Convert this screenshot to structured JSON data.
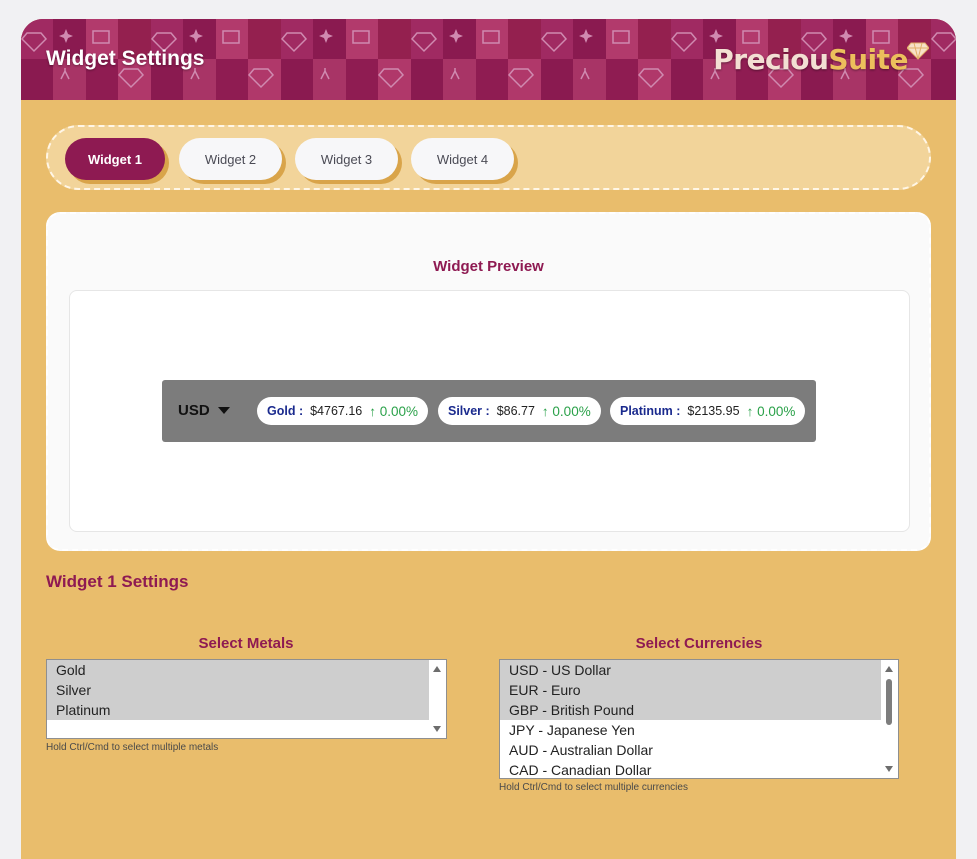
{
  "header": {
    "title": "Widget Settings",
    "brand_part1": "Preciou",
    "brand_part2": "Suite",
    "brand_icon": "diamond-icon"
  },
  "tabs": [
    {
      "label": "Widget 1",
      "active": true
    },
    {
      "label": "Widget 2",
      "active": false
    },
    {
      "label": "Widget 3",
      "active": false
    },
    {
      "label": "Widget 4",
      "active": false
    }
  ],
  "preview": {
    "title": "Widget Preview",
    "currency": "USD",
    "items": [
      {
        "metal": "Gold :",
        "price": "$4767.16",
        "change": "↑ 0.00%"
      },
      {
        "metal": "Silver :",
        "price": "$86.77",
        "change": "↑ 0.00%"
      },
      {
        "metal": "Platinum :",
        "price": "$2135.95",
        "change": "↑ 0.00%"
      }
    ]
  },
  "settings": {
    "title": "Widget 1 Settings",
    "metals": {
      "label": "Select Metals",
      "options": [
        {
          "text": "Gold",
          "selected": true
        },
        {
          "text": "Silver",
          "selected": true
        },
        {
          "text": "Platinum",
          "selected": true
        }
      ],
      "hint": "Hold Ctrl/Cmd to select multiple metals"
    },
    "currencies": {
      "label": "Select Currencies",
      "options": [
        {
          "text": "USD - US Dollar",
          "selected": true
        },
        {
          "text": "EUR - Euro",
          "selected": true
        },
        {
          "text": "GBP - British Pound",
          "selected": true
        },
        {
          "text": "JPY - Japanese Yen",
          "selected": false
        },
        {
          "text": "AUD - Australian Dollar",
          "selected": false
        },
        {
          "text": "CAD - Canadian Dollar",
          "selected": false
        }
      ],
      "hint": "Hold Ctrl/Cmd to select multiple currencies"
    }
  },
  "colors": {
    "brand": "#8e1a52",
    "background": "#e9bd6c",
    "positive": "#2aa149"
  }
}
